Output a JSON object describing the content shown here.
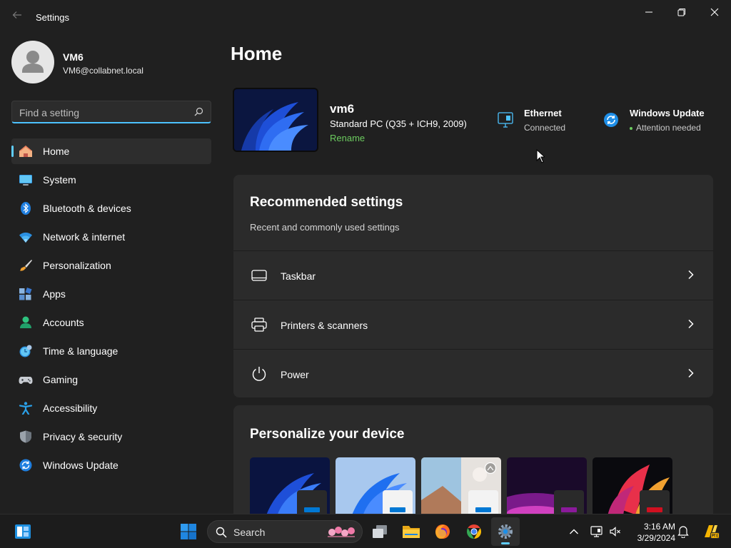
{
  "window": {
    "title": "Settings"
  },
  "profile": {
    "name": "VM6",
    "email": "VM6@collabnet.local"
  },
  "search": {
    "placeholder": "Find a setting"
  },
  "sidebar": {
    "items": [
      {
        "label": "Home",
        "icon": "home-icon",
        "active": true
      },
      {
        "label": "System",
        "icon": "system-icon"
      },
      {
        "label": "Bluetooth & devices",
        "icon": "bluetooth-icon"
      },
      {
        "label": "Network & internet",
        "icon": "wifi-icon"
      },
      {
        "label": "Personalization",
        "icon": "brush-icon"
      },
      {
        "label": "Apps",
        "icon": "apps-icon"
      },
      {
        "label": "Accounts",
        "icon": "accounts-icon"
      },
      {
        "label": "Time & language",
        "icon": "clock-globe-icon"
      },
      {
        "label": "Gaming",
        "icon": "gamepad-icon"
      },
      {
        "label": "Accessibility",
        "icon": "accessibility-icon"
      },
      {
        "label": "Privacy & security",
        "icon": "shield-icon"
      },
      {
        "label": "Windows Update",
        "icon": "update-icon"
      }
    ]
  },
  "main": {
    "title": "Home",
    "device": {
      "name": "vm6",
      "model": "Standard PC (Q35 + ICH9, 2009)",
      "rename": "Rename"
    },
    "status": {
      "ethernet": {
        "title": "Ethernet",
        "sub": "Connected"
      },
      "update": {
        "title": "Windows Update",
        "sub": "Attention needed"
      }
    },
    "recommended": {
      "title": "Recommended settings",
      "subtitle": "Recent and commonly used settings",
      "items": [
        {
          "label": "Taskbar",
          "icon": "taskbar-icon"
        },
        {
          "label": "Printers & scanners",
          "icon": "printer-icon"
        },
        {
          "label": "Power",
          "icon": "power-icon"
        }
      ]
    },
    "personalize": {
      "title": "Personalize your device"
    }
  },
  "taskbar": {
    "search_label": "Search",
    "time": "3:16 AM",
    "date": "3/29/2024"
  },
  "colors": {
    "accent": "#60cdff",
    "rename_link": "#6ccb5f",
    "background": "#202020",
    "card": "#2b2b2b"
  }
}
